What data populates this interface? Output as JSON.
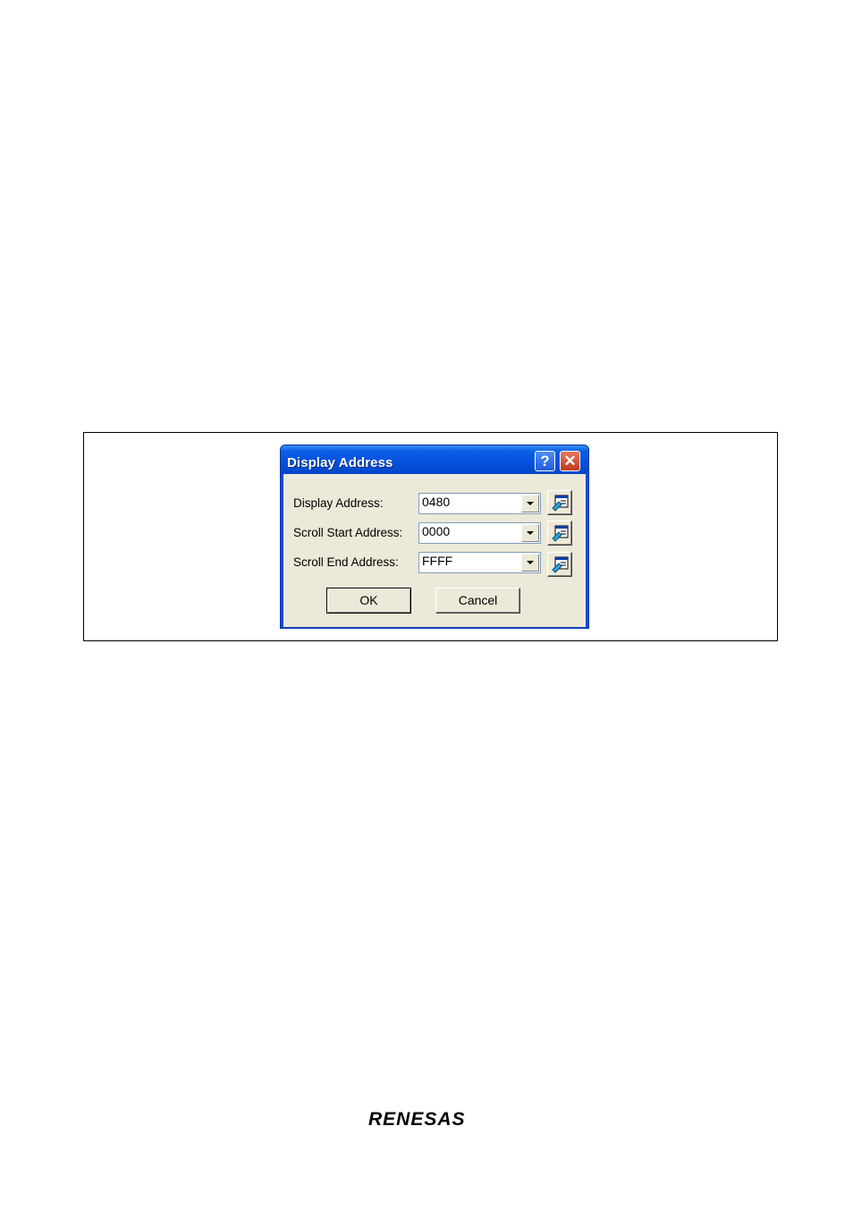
{
  "dialog": {
    "title": "Display Address",
    "help_label": "?",
    "close_label": "✕",
    "fields": [
      {
        "label": "Display Address:",
        "value": "0480"
      },
      {
        "label": "Scroll Start Address:",
        "value": "0000"
      },
      {
        "label": "Scroll End Address:",
        "value": "FFFF"
      }
    ],
    "ok_label": "OK",
    "cancel_label": "Cancel"
  },
  "footer": {
    "logo_text": "RENESAS"
  },
  "icons": {
    "help": "help-icon",
    "close": "close-icon",
    "dropdown": "chevron-down-icon",
    "picker": "symbol-browse-icon"
  }
}
